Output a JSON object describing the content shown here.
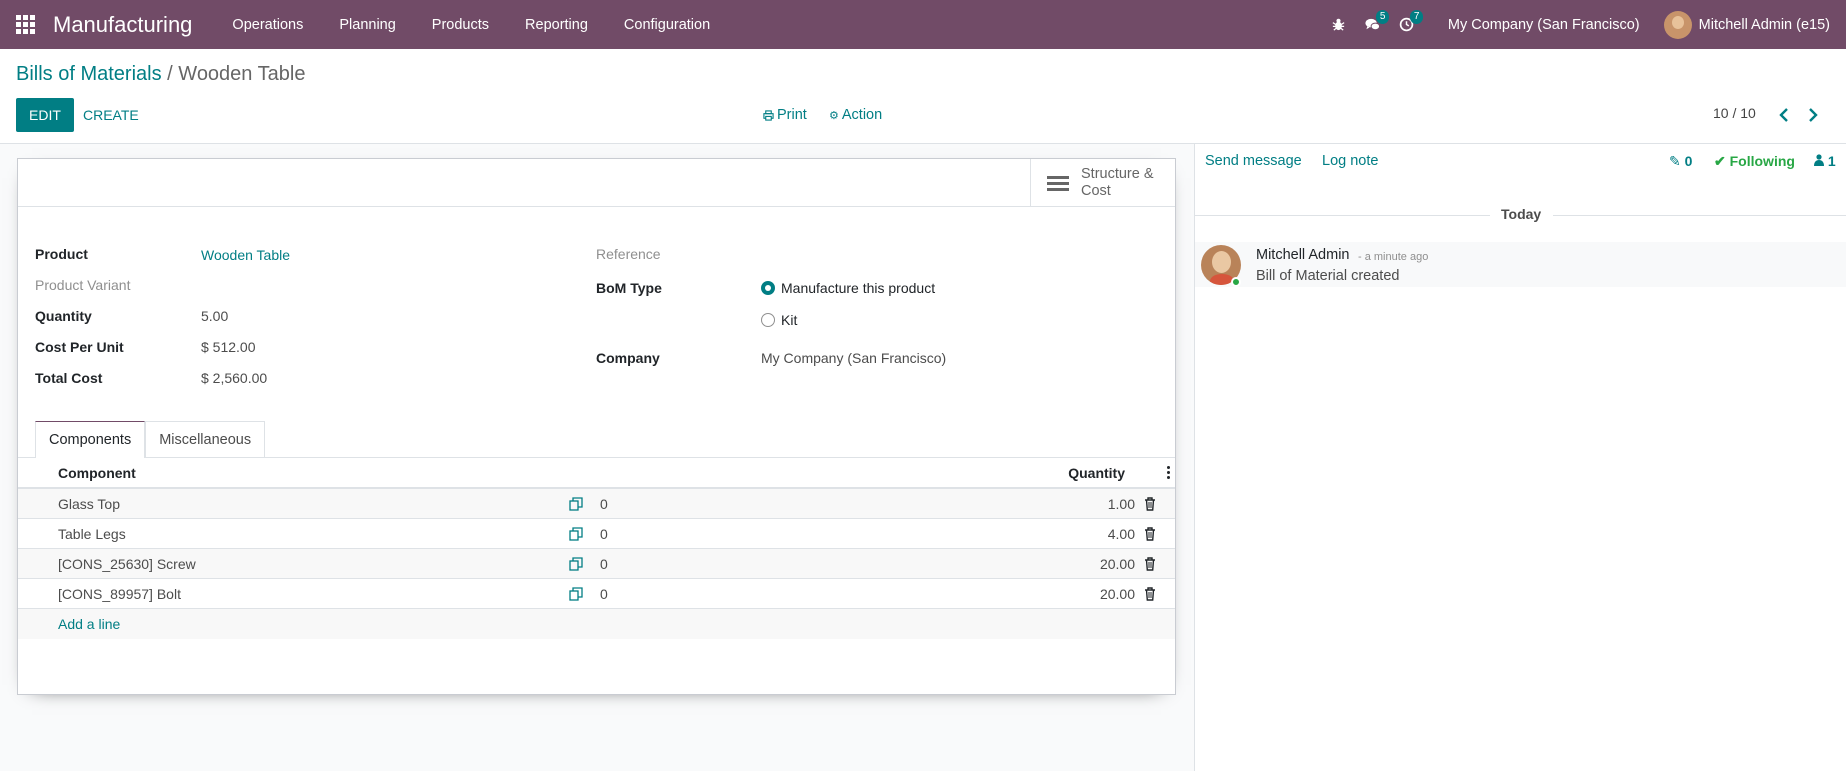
{
  "navbar": {
    "app_name": "Manufacturing",
    "menus": [
      "Operations",
      "Planning",
      "Products",
      "Reporting",
      "Configuration"
    ],
    "messages_badge": "5",
    "activities_badge": "7",
    "company": "My Company (San Francisco)",
    "user": "Mitchell Admin (e15)"
  },
  "breadcrumb": {
    "parent": "Bills of Materials",
    "separator": "/",
    "current": "Wooden Table"
  },
  "toolbar": {
    "edit_label": "EDIT",
    "create_label": "CREATE",
    "print_label": "Print",
    "action_label": "Action",
    "pager": "10 / 10"
  },
  "form": {
    "smart_button": "Structure & Cost",
    "left_fields": [
      {
        "label": "Product",
        "value": "Wooden Table"
      },
      {
        "label": "Product Variant",
        "value": ""
      },
      {
        "label": "Quantity",
        "value": "5.00"
      },
      {
        "label": "Cost Per Unit",
        "value": "$ 512.00"
      },
      {
        "label": "Total Cost",
        "value": "$ 2,560.00"
      }
    ],
    "reference_label": "Reference",
    "bom_type_label": "BoM Type",
    "bom_type_options": [
      "Manufacture this product",
      "Kit"
    ],
    "bom_type_selected": "Manufacture this product",
    "company_label": "Company",
    "company_value": "My Company (San Francisco)"
  },
  "tabs": [
    "Components",
    "Miscellaneous"
  ],
  "components_table": {
    "columns": [
      "Component",
      "Quantity"
    ],
    "rows": [
      {
        "name": "Glass Top",
        "ops": "0",
        "qty": "1.00"
      },
      {
        "name": "Table Legs",
        "ops": "0",
        "qty": "4.00"
      },
      {
        "name": "[CONS_25630] Screw",
        "ops": "0",
        "qty": "20.00"
      },
      {
        "name": "[CONS_89957] Bolt",
        "ops": "0",
        "qty": "20.00"
      }
    ],
    "add_line": "Add a line"
  },
  "chatter": {
    "send_message": "Send message",
    "log_note": "Log note",
    "attachments": "0",
    "following": "Following",
    "followers": "1",
    "date_separator": "Today",
    "message": {
      "author": "Mitchell Admin",
      "date": "- a minute ago",
      "body": "Bill of Material created"
    }
  },
  "colors": {
    "brand": "#714b67",
    "accent": "#017e84",
    "following": "#28a745"
  }
}
